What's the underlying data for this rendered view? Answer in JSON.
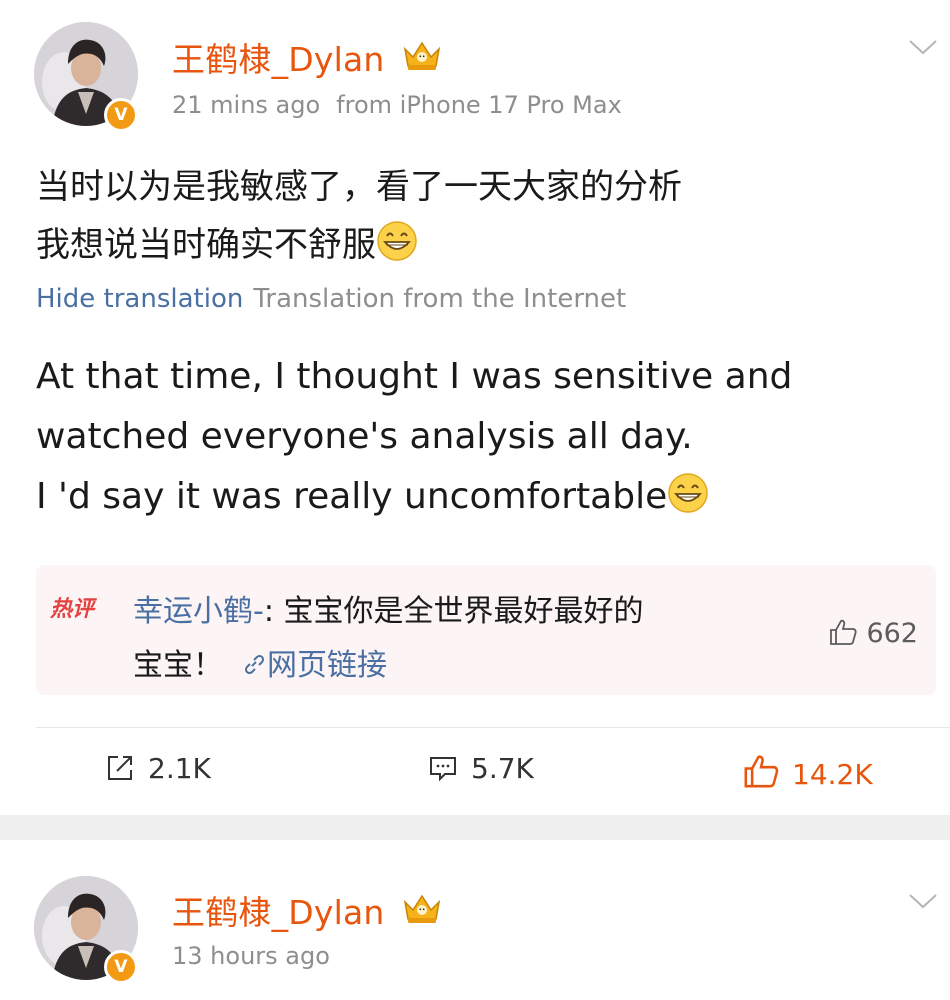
{
  "posts": [
    {
      "username": "王鹤棣_Dylan",
      "time": "21 mins ago",
      "source": "from iPhone 17 Pro Max",
      "text_line1": "当时以为是我敏感了，看了一天大家的分析",
      "text_line2": "我想说当时确实不舒服",
      "hide_translation": "Hide translation",
      "translation_source": "Translation from the Internet",
      "translation_line1": "At that time, I thought I was sensitive and",
      "translation_line2": "watched everyone's analysis all day.",
      "translation_line3": "I 'd say it was really uncomfortable",
      "hot_comment": {
        "tag": "热评",
        "user": "幸运小鹤-",
        "text_line1": ": 宝宝你是全世界最好最好的",
        "text_line2": "宝宝！",
        "link_label": "网页链接",
        "likes": "662"
      },
      "actions": {
        "reposts": "2.1K",
        "comments": "5.7K",
        "likes": "14.2K"
      }
    },
    {
      "username": "王鹤棣_Dylan",
      "time": "13 hours ago"
    }
  ],
  "icons": {
    "verified": "verified-v-badge",
    "crown": "crown-icon",
    "emoji": "grinning-face-emoji",
    "chevron": "chevron-down-icon",
    "repost": "repost-icon",
    "comment": "comment-icon",
    "like": "thumbs-up-icon"
  },
  "colors": {
    "username": "#e8550d",
    "link": "#4a6fa2",
    "meta": "#8e8e8e",
    "hot_tag": "#e44343",
    "like_active": "#e8550d",
    "separator": "#efefef",
    "hot_bg": "#fdf5f5"
  },
  "badge": {
    "verified_letter": "V"
  }
}
